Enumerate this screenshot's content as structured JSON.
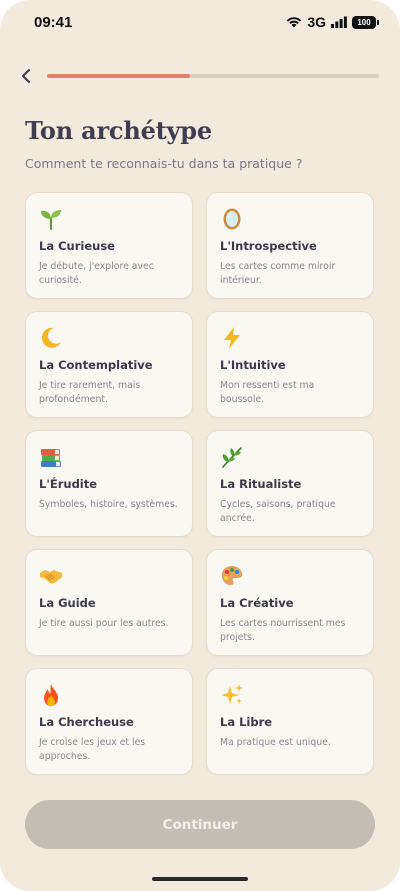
{
  "status_bar": {
    "time": "09:41",
    "network": "3G",
    "battery": "100"
  },
  "progress": {
    "value": 0.43,
    "color": "#e2826d"
  },
  "header": {
    "title": "Ton archétype",
    "subtitle": "Comment te reconnais-tu dans ta pratique ?"
  },
  "cards": [
    {
      "icon": "seedling-icon",
      "title": "La Curieuse",
      "desc": "Je débute, j'explore avec curiosité."
    },
    {
      "icon": "mirror-icon",
      "title": "L'Introspective",
      "desc": "Les cartes comme miroir intérieur."
    },
    {
      "icon": "crescent-moon-icon",
      "title": "La Contemplative",
      "desc": "Je tire rarement, mais profondément."
    },
    {
      "icon": "lightning-icon",
      "title": "L'Intuitive",
      "desc": "Mon ressenti est ma boussole."
    },
    {
      "icon": "books-icon",
      "title": "L'Érudite",
      "desc": "Symboles, histoire, systèmes."
    },
    {
      "icon": "herb-icon",
      "title": "La Ritualiste",
      "desc": "Cycles, saisons, pratique ancrée."
    },
    {
      "icon": "handshake-icon",
      "title": "La Guide",
      "desc": "Je tire aussi pour les autres."
    },
    {
      "icon": "palette-icon",
      "title": "La Créative",
      "desc": "Les cartes nourrissent mes projets."
    },
    {
      "icon": "fire-icon",
      "title": "La Chercheuse",
      "desc": "Je croise les jeux et les approches."
    },
    {
      "icon": "sparkles-icon",
      "title": "La Libre",
      "desc": "Ma pratique est unique."
    }
  ],
  "footer": {
    "continue_label": "Continuer"
  }
}
